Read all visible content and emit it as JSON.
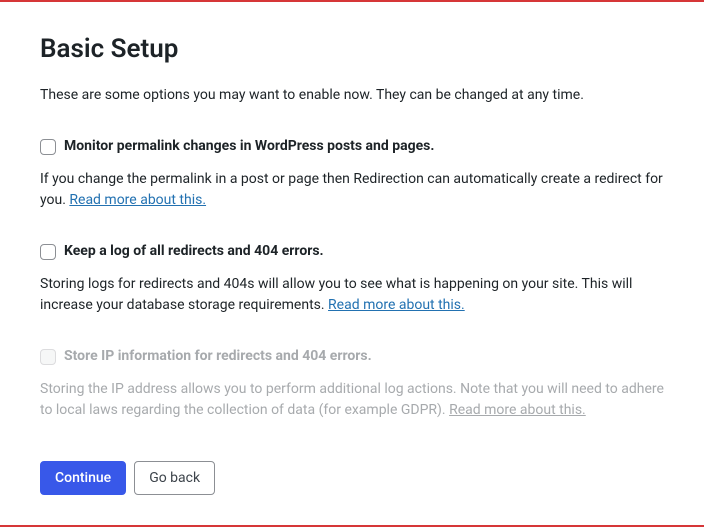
{
  "title": "Basic Setup",
  "intro": "These are some options you may want to enable now. They can be changed at any time.",
  "options": [
    {
      "label": "Monitor permalink changes in WordPress posts and pages.",
      "desc_prefix": "If you change the permalink in a post or page then Redirection can automatically create a redirect for you. ",
      "link_text": "Read more about this.",
      "enabled": true
    },
    {
      "label": "Keep a log of all redirects and 404 errors.",
      "desc_prefix": "Storing logs for redirects and 404s will allow you to see what is happening on your site. This will increase your database storage requirements. ",
      "link_text": "Read more about this.",
      "enabled": true
    },
    {
      "label": "Store IP information for redirects and 404 errors.",
      "desc_prefix": "Storing the IP address allows you to perform additional log actions. Note that you will need to adhere to local laws regarding the collection of data (for example GDPR). ",
      "link_text": "Read more about this.",
      "enabled": false
    }
  ],
  "buttons": {
    "continue": "Continue",
    "go_back": "Go back"
  }
}
